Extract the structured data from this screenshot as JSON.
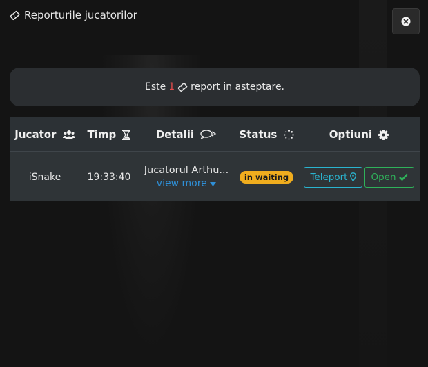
{
  "header": {
    "title": "Reporturile jucatorilor"
  },
  "banner": {
    "prefix": "Este",
    "count": "1",
    "suffix": "report in asteptare."
  },
  "table": {
    "columns": [
      "Jucator",
      "Timp",
      "Detalii",
      "Status",
      "Optiuni"
    ],
    "rows": [
      {
        "player": "iSnake",
        "time": "19:33:40",
        "details": "Jucatorul Arthu...",
        "view_more": "view more",
        "status": "in waiting",
        "teleport_label": "Teleport",
        "open_label": "Open"
      }
    ]
  },
  "colors": {
    "count": "#e44b4b",
    "status_badge": "#f0ad1e",
    "teleport": "#2ab4cf",
    "open": "#2fb15a",
    "link": "#2f8fd6"
  }
}
